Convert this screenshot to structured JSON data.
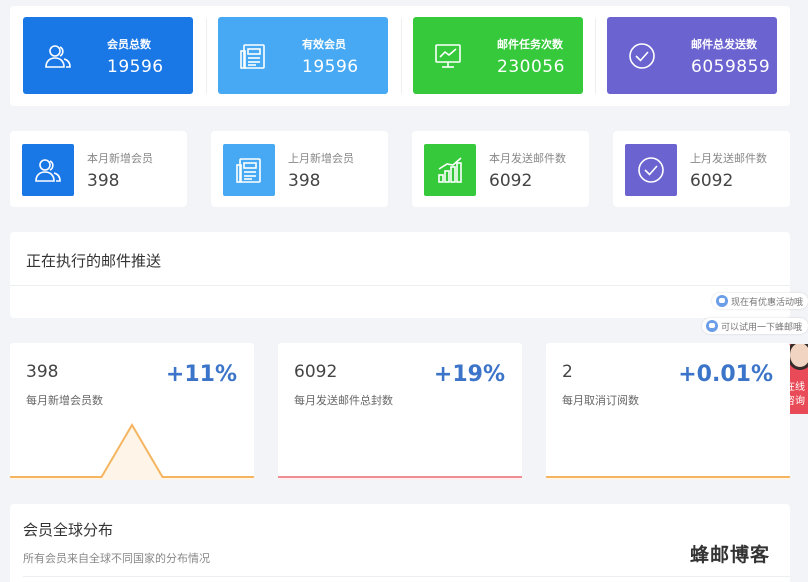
{
  "colors": {
    "blue": "#1977e6",
    "light_blue": "#47a9f3",
    "green": "#36c93c",
    "purple": "#6b63cf",
    "pct_blue": "#3b74c8",
    "chart_orange": "#f5b560",
    "chart_red": "#ef8d93"
  },
  "top_stats": [
    {
      "label": "会员总数",
      "value": "19596",
      "icon": "users-icon"
    },
    {
      "label": "有效会员",
      "value": "19596",
      "icon": "newspaper-icon"
    },
    {
      "label": "邮件任务次数",
      "value": "230056",
      "icon": "monitor-chart-icon"
    },
    {
      "label": "邮件总发送数",
      "value": "6059859",
      "icon": "check-circle-icon"
    }
  ],
  "mid_stats": [
    {
      "label": "本月新增会员",
      "value": "398",
      "icon": "users-icon"
    },
    {
      "label": "上月新增会员",
      "value": "398",
      "icon": "newspaper-icon"
    },
    {
      "label": "本月发送邮件数",
      "value": "6092",
      "icon": "bar-chart-icon"
    },
    {
      "label": "上月发送邮件数",
      "value": "6092",
      "icon": "check-circle-icon"
    }
  ],
  "push_panel": {
    "title": "正在执行的邮件推送"
  },
  "chat": {
    "bubble_1": "现在有优惠活动哦",
    "bubble_2": "可以试用一下蜂邮哦",
    "consult_line1": "在线",
    "consult_line2": "咨询"
  },
  "trend_cards": [
    {
      "number": "398",
      "percent": "+11%",
      "label": "每月新增会员数",
      "spark": [
        0,
        0,
        0,
        0,
        1,
        0,
        0,
        0,
        0
      ],
      "line_color": "#f5b560"
    },
    {
      "number": "6092",
      "percent": "+19%",
      "label": "每月发送邮件总封数",
      "spark": [
        0,
        0,
        0,
        0,
        0,
        0,
        0,
        0,
        0
      ],
      "line_color": "#ef8d93"
    },
    {
      "number": "2",
      "percent": "+0.01%",
      "label": "每月取消订阅数",
      "spark": [
        0,
        0,
        0,
        0,
        0,
        0,
        0,
        0,
        0
      ],
      "line_color": "#f5b560"
    }
  ],
  "dist_panel": {
    "title": "会员全球分布",
    "subtitle": "所有会员来自全球不同国家的分布情况"
  },
  "watermark": "蜂邮博客"
}
